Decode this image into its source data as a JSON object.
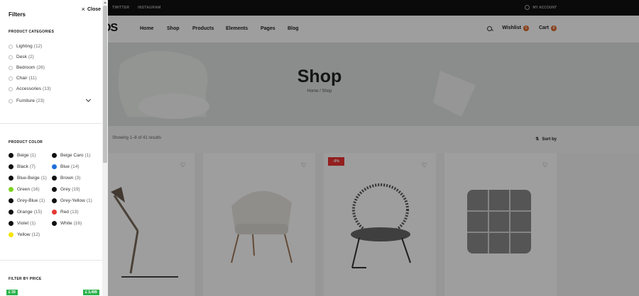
{
  "topbar": {
    "links": [
      "TWITTER",
      "INSTAGRAM"
    ],
    "account": "MY ACCOUNT"
  },
  "nav": {
    "logo": "OS",
    "menu": [
      "Home",
      "Shop",
      "Products",
      "Elements",
      "Pages",
      "Blog"
    ],
    "wishlist_label": "Wishlist",
    "wishlist_count": "1",
    "cart_label": "Cart",
    "cart_count": "0"
  },
  "hero": {
    "title": "Shop",
    "breadcrumb": "Home / Shop"
  },
  "toolbar": {
    "results": "Showing 1–8 of 41 results",
    "sort_label": "Sort by"
  },
  "products": {
    "sale_badge": "-9%"
  },
  "filters": {
    "title": "Filters",
    "close_label": "Close",
    "categories_title": "PRODUCT CATEGORIES",
    "categories": [
      {
        "label": "Lighting",
        "count": "(12)"
      },
      {
        "label": "Desk",
        "count": "(2)"
      },
      {
        "label": "Bedroom",
        "count": "(26)"
      },
      {
        "label": "Chair",
        "count": "(11)"
      },
      {
        "label": "Accessories",
        "count": "(13)"
      },
      {
        "label": "Furniture",
        "count": "(23)"
      }
    ],
    "color_title": "PRODUCT COLOR",
    "colors": [
      {
        "label": "Beige",
        "count": "(1)",
        "color": "#111111"
      },
      {
        "label": "Beige Caro",
        "count": "(1)",
        "color": "#111111"
      },
      {
        "label": "Black",
        "count": "(7)",
        "color": "#111111"
      },
      {
        "label": "Blue",
        "count": "(14)",
        "color": "#1e6fd9"
      },
      {
        "label": "Blue-Beige",
        "count": "(1)",
        "color": "#111111"
      },
      {
        "label": "Brown",
        "count": "(3)",
        "color": "#111111"
      },
      {
        "label": "Green",
        "count": "(16)",
        "color": "#7ed321"
      },
      {
        "label": "Grey",
        "count": "(19)",
        "color": "#111111"
      },
      {
        "label": "Grey-Blue",
        "count": "(1)",
        "color": "#111111"
      },
      {
        "label": "Grey-Yellow",
        "count": "(1)",
        "color": "#111111"
      },
      {
        "label": "Orange",
        "count": "(15)",
        "color": "#111111"
      },
      {
        "label": "Red",
        "count": "(13)",
        "color": "#e53935"
      },
      {
        "label": "Violet",
        "count": "(1)",
        "color": "#111111"
      },
      {
        "label": "White",
        "count": "(16)",
        "color": "#111111"
      },
      {
        "label": "Yellow",
        "count": "(12)",
        "color": "#f5e400"
      }
    ],
    "price_title": "FILTER BY PRICE",
    "price_min": "£ 39",
    "price_max": "£ 3,499"
  }
}
